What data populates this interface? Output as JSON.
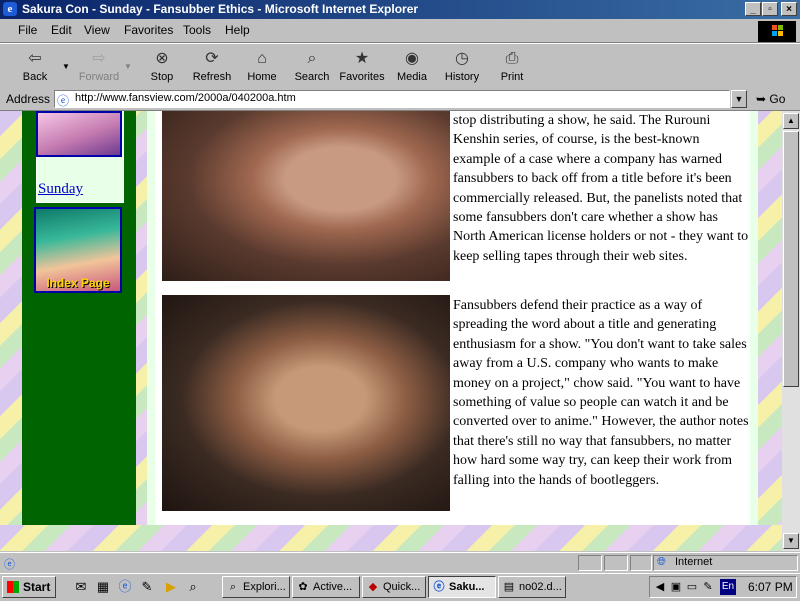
{
  "window": {
    "title": "Sakura Con - Sunday - Fansubber Ethics - Microsoft Internet Explorer",
    "controls": [
      "_",
      "▫",
      "×"
    ]
  },
  "menu": [
    {
      "label": "File",
      "key": "F",
      "rest": "ile"
    },
    {
      "label": "Edit",
      "key": "E",
      "rest": "dit"
    },
    {
      "label": "View",
      "key": "V",
      "rest": "iew"
    },
    {
      "label": "Favorites",
      "key": "a",
      "pre": "F",
      "rest": "vorites"
    },
    {
      "label": "Tools",
      "key": "T",
      "rest": "ools"
    },
    {
      "label": "Help",
      "key": "H",
      "rest": "elp"
    }
  ],
  "toolbar": {
    "back": "Back",
    "forward": "Forward",
    "stop": "Stop",
    "refresh": "Refresh",
    "home": "Home",
    "search": "Search",
    "favorites": "Favorites",
    "media": "Media",
    "history": "History",
    "print": "Print"
  },
  "address": {
    "label": "Address",
    "url": "http://www.fansview.com/2000a/040200a.htm",
    "go": "Go"
  },
  "sidebar": {
    "sunday_link": "Sunday",
    "index_label": "Index Page"
  },
  "article": {
    "para1": "stop distributing a show, he said. The Rurouni Kenshin series, of course, is the best-known example of a case where a company has warned fansubbers to back off from a title before it's been commercially released. But, the panelists noted that some fansubbers don't care whether a show has North American license holders or not - they want to keep selling tapes through their web sites.",
    "para2": "Fansubbers defend their practice as a way of spreading the word about a title and generating enthusiasm for a show. \"You don't want to take sales away from a U.S. company who wants to make money on a project,\" chow said. \"You want to have something of value so people can watch it and be converted over to anime.\" However, the author notes that there's still no way that fansubbers, no matter how hard some way try, can keep their work from falling into the hands of bootleggers."
  },
  "status": {
    "zone": "Internet"
  },
  "taskbar": {
    "start": "Start",
    "tasks": [
      "Explori...",
      "Active...",
      "Quick...",
      "Saku...",
      "no02.d..."
    ],
    "lang": "En",
    "clock": "6:07 PM"
  }
}
